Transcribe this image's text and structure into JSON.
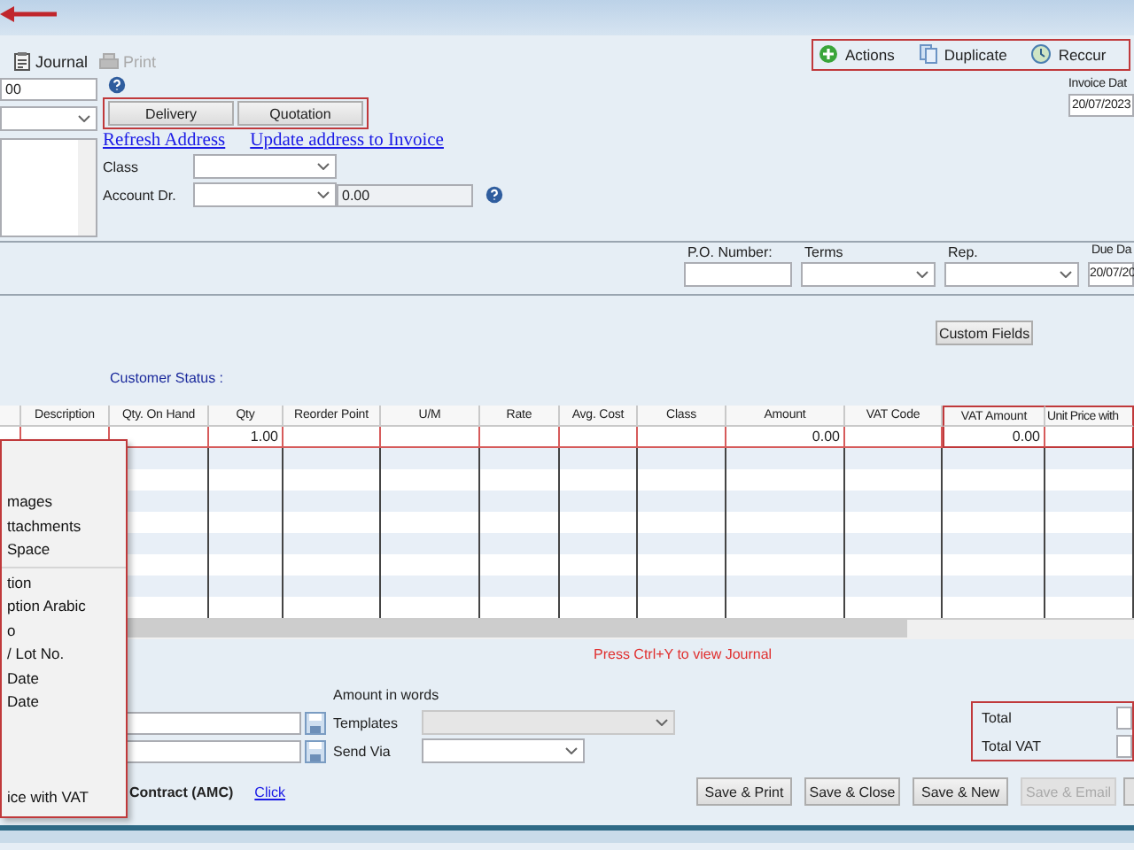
{
  "toolbar": {
    "items": [
      {
        "label": "Journal",
        "kind": "journal",
        "disabled": false
      },
      {
        "label": "Print",
        "kind": "print",
        "disabled": true
      }
    ]
  },
  "actions_bar": {
    "highlighted": true,
    "items": [
      {
        "label": "Actions",
        "kind": "add"
      },
      {
        "label": "Duplicate",
        "kind": "copy"
      },
      {
        "label": "Reccur",
        "kind": "recur"
      }
    ]
  },
  "header": {
    "number_value": "00",
    "copy_buttons": {
      "highlighted": true,
      "buttons": [
        "Delivery",
        "Quotation"
      ]
    },
    "links": [
      "Refresh Address",
      "Update address to Invoice"
    ],
    "class_label": "Class",
    "account_label": "Account Dr.",
    "account_amount": "0.00",
    "invoice_date_label": "Invoice Dat",
    "invoice_date": "20/07/2023"
  },
  "details": {
    "fields": [
      {
        "label": "P.O. Number:",
        "kind": "text"
      },
      {
        "label": "Terms",
        "kind": "select"
      },
      {
        "label": "Rep.",
        "kind": "select"
      },
      {
        "label": "Due Da",
        "kind": "text",
        "value": "20/07/20"
      }
    ]
  },
  "custom_fields_button": "Custom Fields",
  "customer_status_label": "Customer Status :",
  "table": {
    "columns": [
      {
        "label": "Description",
        "highlighted": false
      },
      {
        "label": "Qty. On Hand",
        "highlighted": false
      },
      {
        "label": "Qty",
        "highlighted": false
      },
      {
        "label": "Reorder Point",
        "highlighted": false
      },
      {
        "label": "U/M",
        "highlighted": false
      },
      {
        "label": "Rate",
        "highlighted": false
      },
      {
        "label": "Avg. Cost",
        "highlighted": false
      },
      {
        "label": "Class",
        "highlighted": false
      },
      {
        "label": "Amount",
        "highlighted": false
      },
      {
        "label": "VAT Code",
        "highlighted": false
      },
      {
        "label": "VAT Amount",
        "highlighted": true
      },
      {
        "label": "Unit Price with",
        "highlighted": true
      }
    ],
    "rows": [
      {
        "cells": [
          null,
          null,
          "1.00",
          null,
          null,
          null,
          null,
          null,
          "0.00",
          null,
          "0.00",
          null
        ]
      }
    ]
  },
  "context_menu": {
    "highlighted": true,
    "items": [
      {
        "kind": "blank"
      },
      {
        "kind": "blank"
      },
      {
        "kind": "item",
        "label": "mages"
      },
      {
        "kind": "item",
        "label": "ttachments"
      },
      {
        "kind": "item",
        "label": "Space"
      },
      {
        "kind": "separator"
      },
      {
        "kind": "item",
        "label": "tion"
      },
      {
        "kind": "item",
        "label": "ption Arabic"
      },
      {
        "kind": "item",
        "label": "o"
      },
      {
        "kind": "item",
        "label": "/ Lot No."
      },
      {
        "kind": "item",
        "label": "Date"
      },
      {
        "kind": "item",
        "label": "Date"
      },
      {
        "kind": "blank"
      },
      {
        "kind": "blank"
      },
      {
        "kind": "blank"
      },
      {
        "kind": "item",
        "label": "ice with VAT"
      }
    ]
  },
  "journal_hint": "Press Ctrl+Y to view Journal",
  "amount_in_words_label": "Amount in words",
  "footer_fields": [
    {
      "label": "Templates",
      "disabled": true
    },
    {
      "label": "Send Via",
      "disabled": false
    }
  ],
  "totals": {
    "highlighted": true,
    "rows": [
      "Total",
      "Total VAT"
    ]
  },
  "contract": {
    "label": "Contract (AMC)",
    "link": "Click"
  },
  "buttons": [
    {
      "label": "Save & Print",
      "disabled": false
    },
    {
      "label": "Save & Close",
      "disabled": false
    },
    {
      "label": "Save & New",
      "disabled": false
    },
    {
      "label": "Save & Email",
      "disabled": true
    }
  ]
}
